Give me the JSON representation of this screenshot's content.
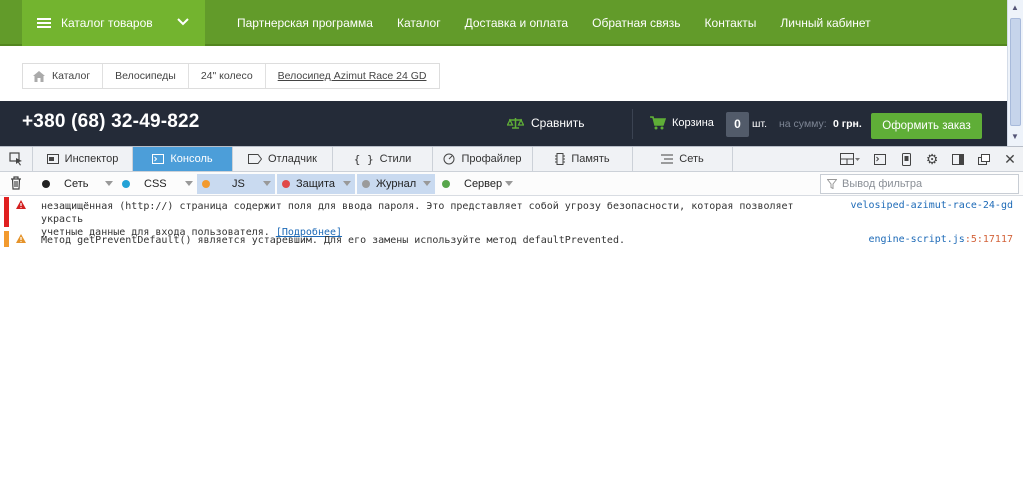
{
  "site": {
    "catalog_button": "Каталог товаров",
    "nav": [
      "Партнерская программа",
      "Каталог",
      "Доставка и оплата",
      "Обратная связь",
      "Контакты",
      "Личный кабинет"
    ],
    "breadcrumbs": [
      "Каталог",
      "Велосипеды",
      "24\" колесо",
      "Велосипед Azimut Race 24 GD"
    ],
    "phone": "+380 (68) 32-49-822",
    "compare": "Сравнить",
    "cart": "Корзина",
    "cart_count": "0",
    "cart_unit": "шт.",
    "sum_label": "на сумму:",
    "sum_value": "0 грн.",
    "order_button": "Оформить заказ",
    "colors": {
      "nav_green": "#629b2a",
      "catalog_green": "#73b42f",
      "dark_bar": "#242b38",
      "order_green": "#5fae37"
    }
  },
  "devtools": {
    "tabs": [
      {
        "label": "Инспектор",
        "icon": "inspector-icon"
      },
      {
        "label": "Консоль",
        "icon": "console-icon"
      },
      {
        "label": "Отладчик",
        "icon": "debugger-icon"
      },
      {
        "label": "Стили",
        "icon": "style-editor-icon"
      },
      {
        "label": "Профайлер",
        "icon": "profiler-icon"
      },
      {
        "label": "Память",
        "icon": "memory-icon"
      },
      {
        "label": "Сеть",
        "icon": "network-icon"
      }
    ],
    "active_tab": "Консоль",
    "filters": [
      {
        "label": "Сеть",
        "color": "#222222",
        "active": false
      },
      {
        "label": "CSS",
        "color": "#24a2d6",
        "active": false
      },
      {
        "label": "JS",
        "color": "#f29a2e",
        "active": true
      },
      {
        "label": "Защита",
        "color": "#e04848",
        "active": true
      },
      {
        "label": "Журнал",
        "color": "#9b9b9b",
        "active": true
      },
      {
        "label": "Сервер",
        "color": "#58a64c",
        "active": false
      }
    ],
    "filter_placeholder": "Вывод фильтра",
    "messages": [
      {
        "text_line1": "незащищённая (http://) страница содержит поля для ввода пароля. Это представляет собой угрозу безопасности, которая позволяет украсть",
        "text_line2": "учетные данные для входа пользователя.",
        "link": "[Подробнее]",
        "source": "velosiped-azimut-race-24-gd",
        "marker_color": "#e02020"
      },
      {
        "text_line1": "Метод getPreventDefault() является устаревшим. Для его замены используйте метод defaultPrevented.",
        "source": "engine-script.js",
        "source_line": ":5:17117",
        "marker_color": "#f29a2e"
      }
    ]
  }
}
